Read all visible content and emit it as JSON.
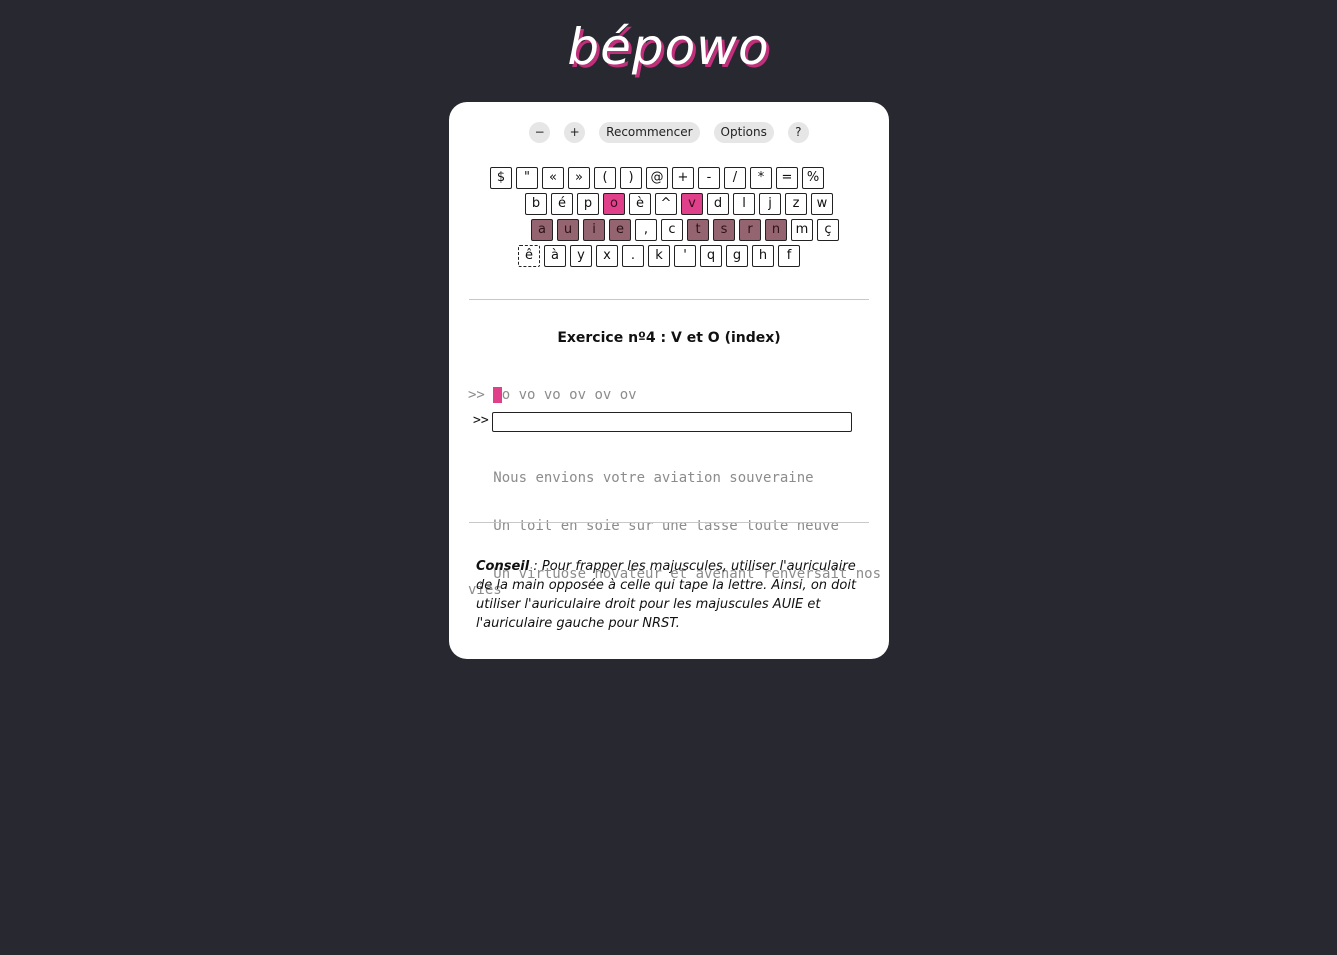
{
  "logo": "bépowo",
  "toolbar": {
    "zoom_out": "−",
    "zoom_in": "+",
    "restart": "Recommencer",
    "options": "Options",
    "help": "?"
  },
  "keyboard": {
    "rows": [
      [
        {
          "label": "$",
          "state": "normal"
        },
        {
          "label": "\"",
          "state": "normal"
        },
        {
          "label": "«",
          "state": "normal"
        },
        {
          "label": "»",
          "state": "normal"
        },
        {
          "label": "(",
          "state": "normal"
        },
        {
          "label": ")",
          "state": "normal"
        },
        {
          "label": "@",
          "state": "normal"
        },
        {
          "label": "+",
          "state": "normal"
        },
        {
          "label": "-",
          "state": "normal"
        },
        {
          "label": "/",
          "state": "normal"
        },
        {
          "label": "*",
          "state": "normal"
        },
        {
          "label": "=",
          "state": "normal"
        },
        {
          "label": "%",
          "state": "normal"
        }
      ],
      [
        {
          "label": "b",
          "state": "normal"
        },
        {
          "label": "é",
          "state": "normal"
        },
        {
          "label": "p",
          "state": "normal"
        },
        {
          "label": "o",
          "state": "active"
        },
        {
          "label": "è",
          "state": "normal"
        },
        {
          "label": "^",
          "state": "normal"
        },
        {
          "label": "v",
          "state": "active"
        },
        {
          "label": "d",
          "state": "normal"
        },
        {
          "label": "l",
          "state": "normal"
        },
        {
          "label": "j",
          "state": "normal"
        },
        {
          "label": "z",
          "state": "normal"
        },
        {
          "label": "w",
          "state": "normal"
        }
      ],
      [
        {
          "label": "a",
          "state": "learned"
        },
        {
          "label": "u",
          "state": "learned"
        },
        {
          "label": "i",
          "state": "learned"
        },
        {
          "label": "e",
          "state": "learned"
        },
        {
          "label": ",",
          "state": "normal"
        },
        {
          "label": "c",
          "state": "normal"
        },
        {
          "label": "t",
          "state": "learned"
        },
        {
          "label": "s",
          "state": "learned"
        },
        {
          "label": "r",
          "state": "learned"
        },
        {
          "label": "n",
          "state": "learned"
        },
        {
          "label": "m",
          "state": "normal"
        },
        {
          "label": "ç",
          "state": "normal"
        }
      ],
      [
        {
          "label": "ê",
          "state": "dashed"
        },
        {
          "label": "à",
          "state": "normal"
        },
        {
          "label": "y",
          "state": "normal"
        },
        {
          "label": "x",
          "state": "normal"
        },
        {
          "label": ".",
          "state": "normal"
        },
        {
          "label": "k",
          "state": "normal"
        },
        {
          "label": "'",
          "state": "normal"
        },
        {
          "label": "q",
          "state": "normal"
        },
        {
          "label": "g",
          "state": "normal"
        },
        {
          "label": "h",
          "state": "normal"
        },
        {
          "label": "f",
          "state": "normal"
        }
      ]
    ]
  },
  "exercise": {
    "title": "Exercice nº4 : V et O (index)",
    "prompt_marker": ">> ",
    "current_char": "v",
    "remaining_text": "o vo vo ov ov ov",
    "input_label": ">>",
    "input_value": "",
    "upcoming_lines": [
      "Nous envions votre aviation souveraine",
      "Un toit en soie sur une tasse toute neuve",
      "Un virtuose novateur et avenant renversait nos vies"
    ]
  },
  "tip": {
    "label": "Conseil",
    "separator": " : ",
    "text": "Pour frapper les majuscules, utiliser l'auriculaire de la main opposée à celle qui tape la lettre. Ainsi, on doit utiliser l'auriculaire droit pour les majuscules AUIE et l'auriculaire gauche pour NRST."
  },
  "colors": {
    "background": "#282830",
    "active_key": "#e0408a",
    "learned_key": "#946570",
    "logo_shadow": "#c0307a"
  }
}
